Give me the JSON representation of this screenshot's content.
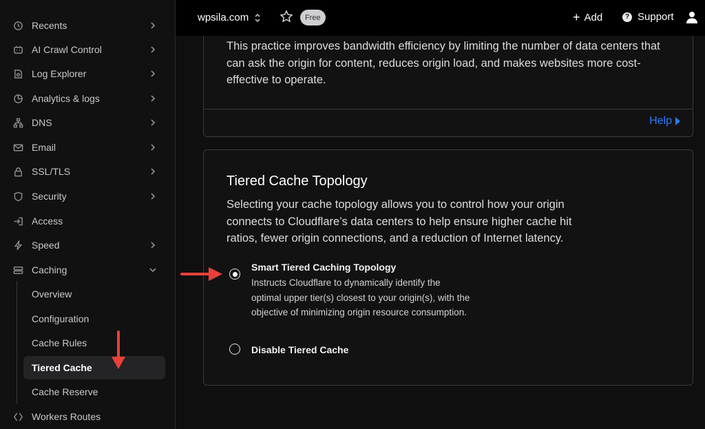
{
  "sidebar": {
    "items": [
      {
        "label": "Recents",
        "icon": "recents-icon",
        "chevron": "right"
      },
      {
        "label": "AI Crawl Control",
        "icon": "ai-crawl-icon",
        "chevron": "right"
      },
      {
        "label": "Log Explorer",
        "icon": "log-explorer-icon",
        "chevron": "right"
      },
      {
        "label": "Analytics & logs",
        "icon": "analytics-icon",
        "chevron": "right"
      },
      {
        "label": "DNS",
        "icon": "dns-icon",
        "chevron": "right"
      },
      {
        "label": "Email",
        "icon": "email-icon",
        "chevron": "right"
      },
      {
        "label": "SSL/TLS",
        "icon": "lock-icon",
        "chevron": "right"
      },
      {
        "label": "Security",
        "icon": "shield-icon",
        "chevron": "right"
      },
      {
        "label": "Access",
        "icon": "access-icon",
        "chevron": ""
      },
      {
        "label": "Speed",
        "icon": "bolt-icon",
        "chevron": "right"
      },
      {
        "label": "Caching",
        "icon": "caching-icon",
        "chevron": "down"
      }
    ],
    "caching_sub": [
      {
        "label": "Overview",
        "active": false
      },
      {
        "label": "Configuration",
        "active": false
      },
      {
        "label": "Cache Rules",
        "active": false
      },
      {
        "label": "Tiered Cache",
        "active": true
      },
      {
        "label": "Cache Reserve",
        "active": false
      }
    ],
    "workers_routes": {
      "label": "Workers Routes",
      "icon": "workers-icon"
    }
  },
  "topbar": {
    "domain": "wpsila.com",
    "plan_badge": "Free",
    "add_label": "Add",
    "support_label": "Support"
  },
  "main": {
    "card1": {
      "description": "This practice improves bandwidth efficiency by limiting the number of data centers that can ask the origin for content, reduces origin load, and makes websites more cost-effective to operate.",
      "help_label": "Help"
    },
    "card2": {
      "title": "Tiered Cache Topology",
      "description": "Selecting your cache topology allows you to control how your origin connects to Cloudflare’s data centers to help ensure higher cache hit ratios, fewer origin connections, and a reduction of Internet latency.",
      "options": [
        {
          "title": "Smart Tiered Caching Topology",
          "description": "Instructs Cloudflare to dynamically identify the optimal upper tier(s) closest to your origin(s), with the objective of minimizing origin resource consumption.",
          "selected": true
        },
        {
          "title": "Disable Tiered Cache",
          "description": "",
          "selected": false
        }
      ]
    }
  },
  "colors": {
    "accent_link": "#2b7cff",
    "annotation_arrow": "#e8413a",
    "background": "#0f0f10"
  }
}
